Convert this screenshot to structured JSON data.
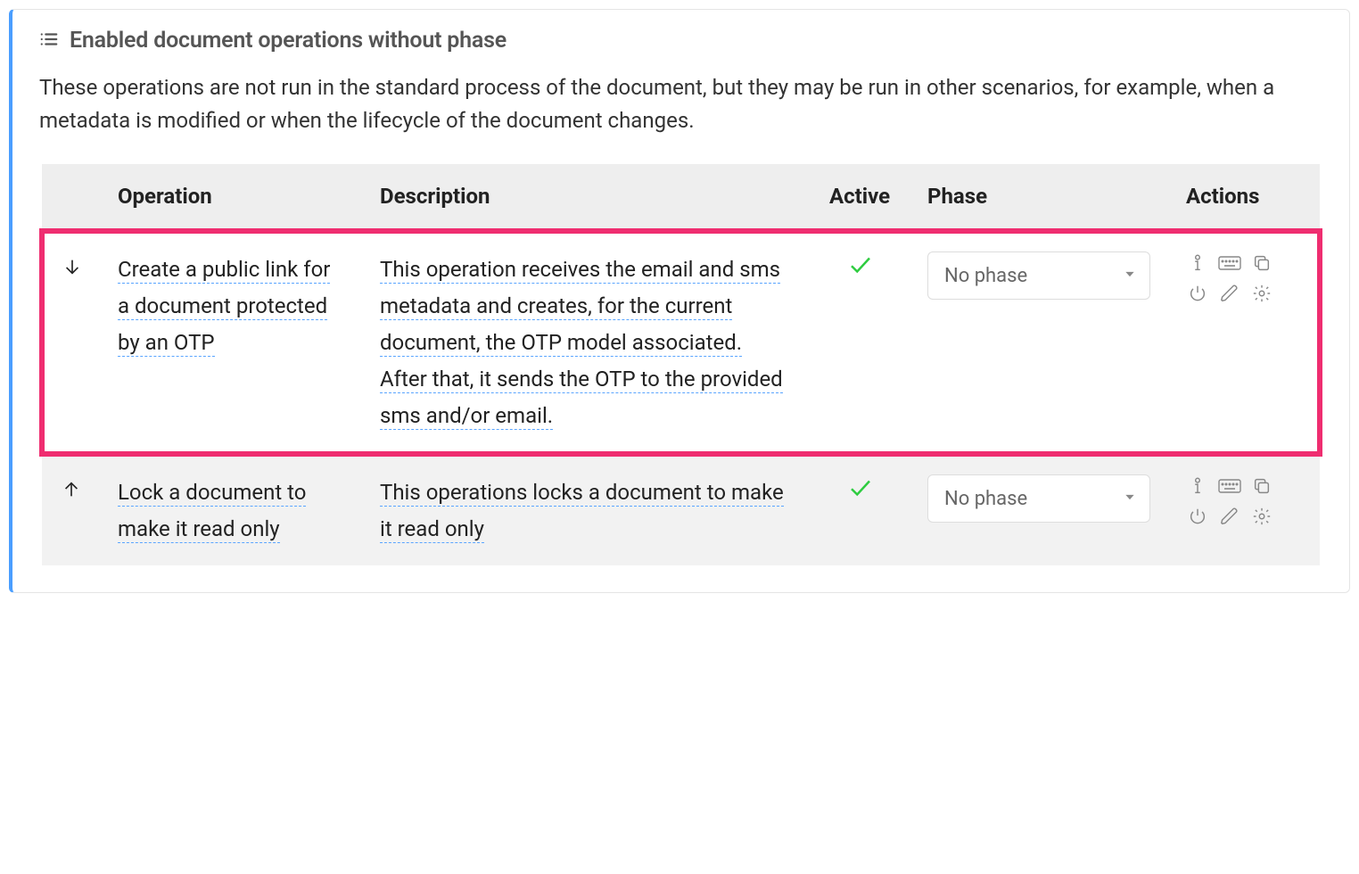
{
  "panel": {
    "title": "Enabled document operations without phase",
    "description": "These operations are not run in the standard process of the document, but they may be run in other scenarios, for example, when a metadata is modified or when the lifecycle of the document changes."
  },
  "table": {
    "headers": {
      "operation": "Operation",
      "description": "Description",
      "active": "Active",
      "phase": "Phase",
      "actions": "Actions"
    },
    "rows": [
      {
        "move": "down",
        "operation": "Create a public link for a document protected by an OTP",
        "description": "This operation receives the email and sms metadata and creates, for the current document, the OTP model associated. After that, it sends the OTP to the provided sms and/or email.",
        "active": true,
        "phase": "No phase",
        "highlight": true
      },
      {
        "move": "up",
        "operation": "Lock a document to make it read only",
        "description": "This operations locks a document to make it read only",
        "active": true,
        "phase": "No phase",
        "highlight": false
      }
    ]
  },
  "icons": {
    "panel_header": "list-icon",
    "actions": [
      "info-icon",
      "keyboard-icon",
      "copy-icon",
      "power-icon",
      "edit-icon",
      "gear-icon"
    ]
  }
}
